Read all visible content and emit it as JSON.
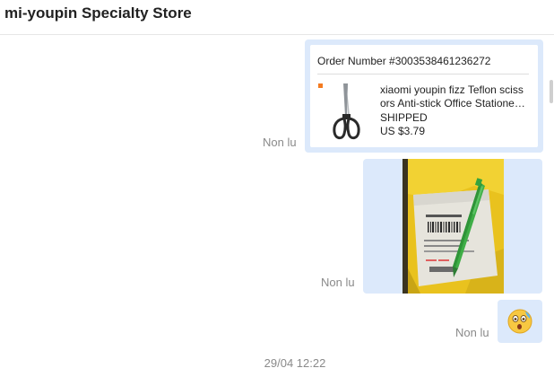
{
  "header": {
    "title": "mi-youpin Specialty Store"
  },
  "messages": [
    {
      "type": "order",
      "status_label": "Non lu",
      "order": {
        "number": "Order Number #3003538461236272",
        "product_name_line1": "xiaomi youpin fizz Teflon sciss",
        "product_name_line2": "ors Anti-stick Office Statione…",
        "status": "SHIPPED",
        "price": "US $3.79",
        "thumbnail_icon": "scissors-icon"
      }
    },
    {
      "type": "image",
      "status_label": "Non lu",
      "image_subject": "green-pen-on-package-photo"
    },
    {
      "type": "emoji",
      "status_label": "Non lu",
      "emoji_icon": "surprised-face-emoji"
    }
  ],
  "timestamp": "29/04 12:22",
  "colors": {
    "bubble": "#dce9fb",
    "status_text": "#8a8a8a",
    "badge": "#f47b20"
  }
}
